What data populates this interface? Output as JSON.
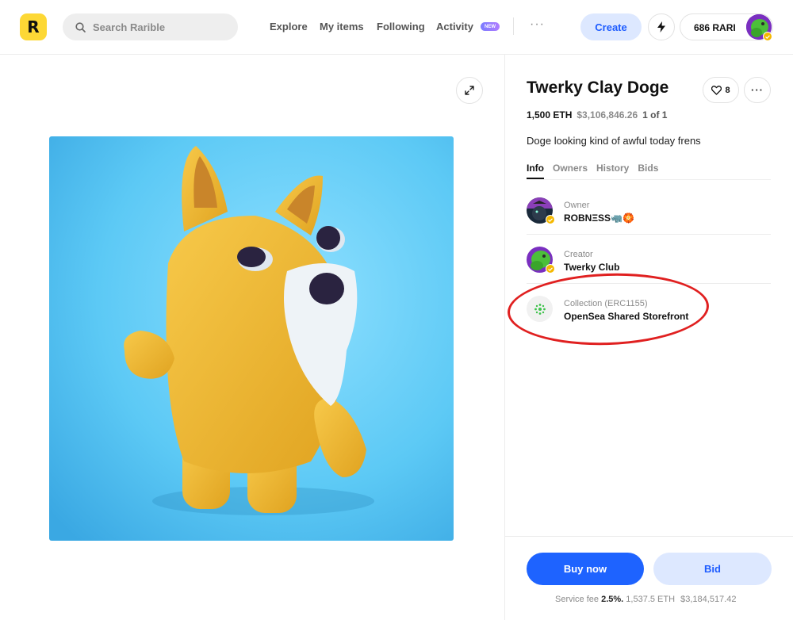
{
  "header": {
    "logo_letter": "R",
    "search_placeholder": "Search Rarible",
    "nav": [
      "Explore",
      "My items",
      "Following",
      "Activity"
    ],
    "activity_badge": "NEW",
    "create_label": "Create",
    "balance": "686 RARI"
  },
  "item": {
    "title": "Twerky Clay Doge",
    "like_count": "8",
    "price_eth": "1,500 ETH",
    "price_usd": "$3,106,846.26",
    "edition": "1 of 1",
    "description": "Doge looking kind of awful today frens"
  },
  "tabs": [
    "Info",
    "Owners",
    "History",
    "Bids"
  ],
  "info": {
    "owner_label": "Owner",
    "owner_name": "ROBNΞSS🦏🏵️",
    "creator_label": "Creator",
    "creator_name": "Twerky Club",
    "collection_label": "Collection (ERC1155)",
    "collection_name": "OpenSea Shared Storefront"
  },
  "actions": {
    "buy_label": "Buy now",
    "bid_label": "Bid"
  },
  "fee": {
    "prefix": "Service fee",
    "percent": "2.5%.",
    "total_eth": "1,537.5 ETH",
    "total_usd": "$3,184,517.42"
  },
  "colors": {
    "accent_blue": "#1e63ff",
    "logo_yellow": "#fdd835",
    "highlight_red": "#e02020"
  }
}
